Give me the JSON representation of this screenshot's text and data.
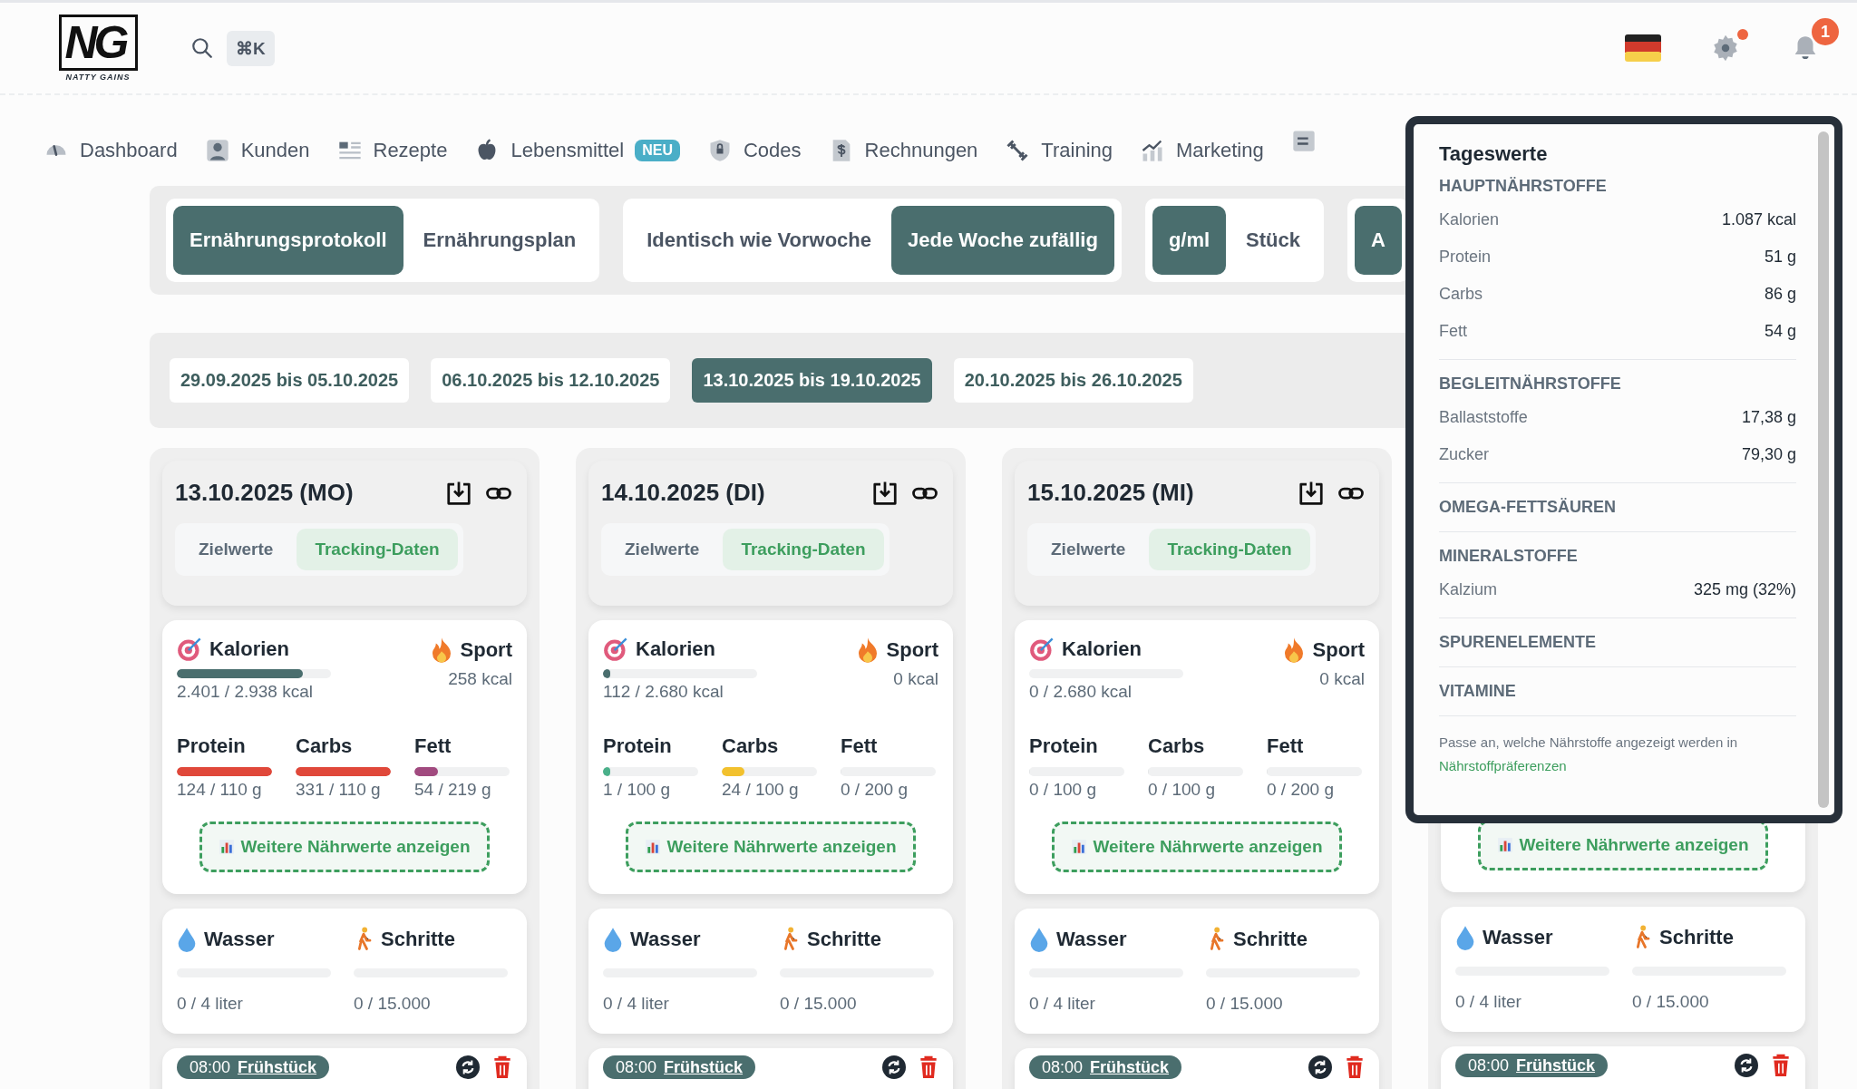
{
  "header": {
    "logo_text": "NG",
    "logo_subtitle": "NATTY GAINS",
    "shortcut": "⌘K",
    "settings_alert": true,
    "notification_count": "1"
  },
  "nav": [
    {
      "label": "Dashboard"
    },
    {
      "label": "Kunden"
    },
    {
      "label": "Rezepte"
    },
    {
      "label": "Lebensmittel",
      "badge": "NEU"
    },
    {
      "label": "Codes"
    },
    {
      "label": "Rechnungen"
    },
    {
      "label": "Training"
    },
    {
      "label": "Marketing"
    }
  ],
  "toggle_groups": [
    {
      "options": [
        {
          "label": "Ernährungsprotokoll",
          "selected": true
        },
        {
          "label": "Ernährungsplan",
          "selected": false
        }
      ]
    },
    {
      "options": [
        {
          "label": "Identisch wie Vorwoche",
          "selected": false
        },
        {
          "label": "Jede Woche zufällig",
          "selected": true
        }
      ]
    },
    {
      "options": [
        {
          "label": "g/ml",
          "selected": true
        },
        {
          "label": "Stück",
          "selected": false
        }
      ]
    },
    {
      "options": [
        {
          "label": "A",
          "selected": true
        }
      ]
    }
  ],
  "weeks": [
    {
      "label": "29.09.2025 bis 05.10.2025",
      "selected": false
    },
    {
      "label": "06.10.2025 bis 12.10.2025",
      "selected": false
    },
    {
      "label": "13.10.2025 bis 19.10.2025",
      "selected": true
    },
    {
      "label": "20.10.2025 bis 26.10.2025",
      "selected": false
    }
  ],
  "days": [
    {
      "date": "13.10.2025 (MO)",
      "tabs": [
        {
          "label": "Zielwerte",
          "selected": false
        },
        {
          "label": "Tracking-Daten",
          "selected": true
        }
      ],
      "calories": {
        "label": "Kalorien",
        "level": 0.82,
        "reading": "2.401 / 2.938 kcal"
      },
      "sport": {
        "label": "Sport",
        "reading": "258 kcal"
      },
      "macros": [
        {
          "name": "Protein",
          "level": 1,
          "color": "#e0483a",
          "reading": "124 / 110 g"
        },
        {
          "name": "Carbs",
          "level": 1,
          "color": "#e0483a",
          "reading": "331 / 110 g"
        },
        {
          "name": "Fett",
          "level": 0.25,
          "color": "#a14a7f",
          "reading": "54 / 219 g"
        }
      ],
      "more_button": "Weitere Nährwerte anzeigen",
      "water": {
        "label": "Wasser",
        "level": 0,
        "reading": "0 / 4 liter"
      },
      "steps": {
        "label": "Schritte",
        "level": 0,
        "reading": "0 / 15.000"
      },
      "meal": {
        "time": "08:00",
        "name": "Frühstück"
      }
    },
    {
      "date": "14.10.2025 (DI)",
      "tabs": [
        {
          "label": "Zielwerte",
          "selected": false
        },
        {
          "label": "Tracking-Daten",
          "selected": true
        }
      ],
      "calories": {
        "label": "Kalorien",
        "level": 0.04,
        "reading": "112 / 2.680 kcal"
      },
      "sport": {
        "label": "Sport",
        "reading": "0 kcal"
      },
      "macros": [
        {
          "name": "Protein",
          "level": 0.01,
          "color": "#4ab08a",
          "reading": "1 / 100 g"
        },
        {
          "name": "Carbs",
          "level": 0.24,
          "color": "#f2c12e",
          "reading": "24 / 100 g"
        },
        {
          "name": "Fett",
          "level": 0,
          "reading": "0 / 200 g"
        }
      ],
      "more_button": "Weitere Nährwerte anzeigen",
      "water": {
        "label": "Wasser",
        "level": 0,
        "reading": "0 / 4 liter"
      },
      "steps": {
        "label": "Schritte",
        "level": 0,
        "reading": "0 / 15.000"
      },
      "meal": {
        "time": "08:00",
        "name": "Frühstück"
      }
    },
    {
      "date": "15.10.2025 (MI)",
      "tabs": [
        {
          "label": "Zielwerte",
          "selected": false
        },
        {
          "label": "Tracking-Daten",
          "selected": true
        }
      ],
      "calories": {
        "label": "Kalorien",
        "level": 0,
        "reading": "0 / 2.680 kcal"
      },
      "sport": {
        "label": "Sport",
        "reading": "0 kcal"
      },
      "macros": [
        {
          "name": "Protein",
          "level": 0,
          "reading": "0 / 100 g"
        },
        {
          "name": "Carbs",
          "level": 0,
          "reading": "0 / 100 g"
        },
        {
          "name": "Fett",
          "level": 0,
          "reading": "0 / 200 g"
        }
      ],
      "more_button": "Weitere Nährwerte anzeigen",
      "water": {
        "label": "Wasser",
        "level": 0,
        "reading": "0 / 4 liter"
      },
      "steps": {
        "label": "Schritte",
        "level": 0,
        "reading": "0 / 15.000"
      },
      "meal": {
        "time": "08:00",
        "name": "Frühstück"
      }
    },
    {
      "more_button": "Weitere Nährwerte anzeigen",
      "water": {
        "label": "Wasser",
        "level": 0,
        "reading": "0 / 4 liter"
      },
      "steps": {
        "label": "Schritte",
        "level": 0,
        "reading": "0 / 15.000"
      },
      "meal": {
        "time": "08:00",
        "name": "Frühstück"
      }
    }
  ],
  "popover": {
    "title": "Tageswerte",
    "sections": [
      {
        "heading": "HAUPTNÄHRSTOFFE",
        "rows": [
          {
            "label": "Kalorien",
            "value": "1.087 kcal"
          },
          {
            "label": "Protein",
            "value": "51 g"
          },
          {
            "label": "Carbs",
            "value": "86 g"
          },
          {
            "label": "Fett",
            "value": "54 g"
          }
        ]
      },
      {
        "heading": "BEGLEITNÄHRSTOFFE",
        "rows": [
          {
            "label": "Ballaststoffe",
            "value": "17,38 g"
          },
          {
            "label": "Zucker",
            "value": "79,30 g"
          }
        ]
      },
      {
        "heading": "OMEGA-FETTSÄUREN"
      },
      {
        "heading": "MINERALSTOFFE",
        "rows": [
          {
            "label": "Kalzium",
            "value": "325 mg (32%)"
          }
        ]
      },
      {
        "heading": "SPURENELEMENTE"
      },
      {
        "heading": "VITAMINE"
      }
    ],
    "footer_text": "Passe an, welche Nährstoffe angezeigt werden in",
    "footer_link": "Nährstoffpräferenzen"
  }
}
